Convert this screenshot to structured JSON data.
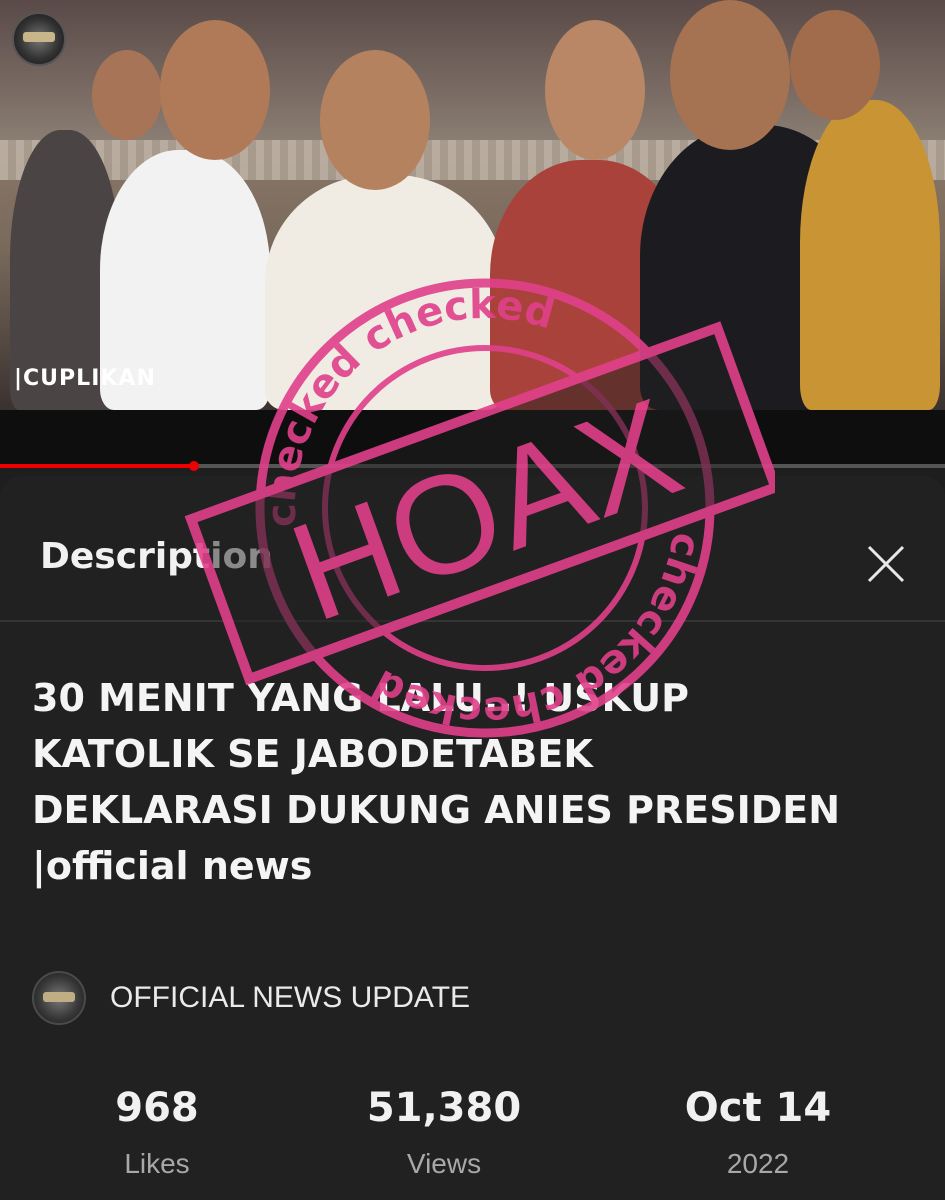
{
  "video": {
    "overlay_label": "|CUPLIKAN",
    "progress_fraction": 0.205
  },
  "sheet": {
    "title": "Description",
    "close_icon": "close-x-icon"
  },
  "description": {
    "title": "30 MENIT YANG LALU..! USKUP\nKATOLIK SE JABODETABEK\nDEKLARASI DUKUNG ANIES PRESIDEN\n|official news",
    "channel_name": "OFFICIAL NEWS UPDATE",
    "stats": [
      {
        "value": "968",
        "label": "Likes"
      },
      {
        "value": "51,380",
        "label": "Views"
      },
      {
        "value": "Oct 14",
        "label": "2022"
      }
    ]
  },
  "stamp": {
    "main_text": "HOAX",
    "ring_text": "checked",
    "color": "#e0408a"
  },
  "colors": {
    "background": "#212121",
    "accent_progress": "#ee0000"
  }
}
